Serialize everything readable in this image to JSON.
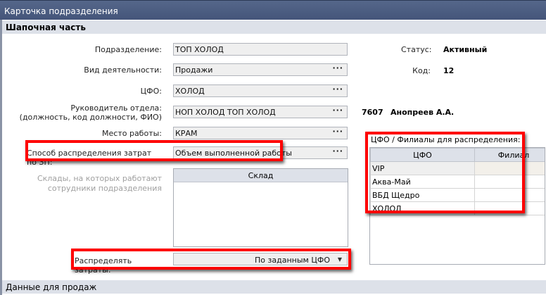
{
  "window": {
    "title": "Карточка подразделения"
  },
  "sections": {
    "header": "Шапочная часть",
    "sales": "Данные для продаж"
  },
  "fields": {
    "division": {
      "label": "Подразделение:",
      "value": "ТОП ХОЛОД"
    },
    "activity": {
      "label": "Вид деятельности:",
      "value": "Продажи"
    },
    "cfo": {
      "label": "ЦФО:",
      "value": "ХОЛОД"
    },
    "head": {
      "label1": "Руководитель отдела:",
      "label2": "(должность, код должности, ФИО)",
      "value": "НОП ХОЛОД ТОП ХОЛОД",
      "code": "7607",
      "name": "Анопреев А.А."
    },
    "workplace": {
      "label": "Место работы:",
      "value": "КРАМ"
    },
    "method": {
      "label": "Способ распределения затрат по ЗП:",
      "value": "Объем выполненной работы"
    },
    "warehouses": {
      "label1": "Склады, на которых работают",
      "label2": "сотрудники подразделения",
      "column": "Склад"
    },
    "distribute": {
      "label": "Распределять затраты:",
      "value": "По заданным ЦФО"
    }
  },
  "status": {
    "label": "Статус:",
    "value": "Активный"
  },
  "code": {
    "label": "Код:",
    "value": "12"
  },
  "cfo_table": {
    "label": "ЦФО / Филиалы для распределения:",
    "columns": [
      "ЦФО",
      "Филиал"
    ],
    "rows": [
      {
        "cfo": "VIP",
        "branch": ""
      },
      {
        "cfo": "Аква-Май",
        "branch": ""
      },
      {
        "cfo": "ВБД Щедро",
        "branch": ""
      },
      {
        "cfo": "ХОЛОД",
        "branch": ""
      }
    ]
  },
  "dots": "···",
  "arrow": "▼"
}
